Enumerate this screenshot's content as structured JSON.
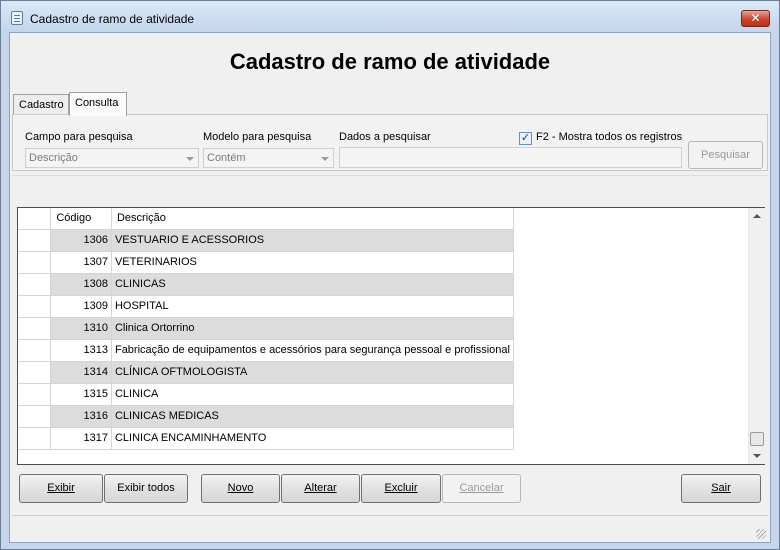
{
  "window": {
    "title": "Cadastro de ramo de atividade",
    "close_glyph": "✕"
  },
  "header": {
    "title": "Cadastro de ramo de atividade"
  },
  "tabs": [
    {
      "label": "Cadastro"
    },
    {
      "label": "Consulta"
    }
  ],
  "search": {
    "campo_label": "Campo para pesquisa",
    "campo_value": "Descrição",
    "modelo_label": "Modelo para pesquisa",
    "modelo_value": "Contém",
    "dados_label": "Dados a pesquisar",
    "dados_value": "",
    "checkbox_label": "F2 - Mostra todos os registros",
    "checkbox_checked": true,
    "pesquisar_label": "Pesquisar"
  },
  "grid": {
    "columns": [
      "Código",
      "Descrição"
    ],
    "rows": [
      {
        "code": "1306",
        "desc": "VESTUARIO E ACESSORIOS"
      },
      {
        "code": "1307",
        "desc": "VETERINARIOS"
      },
      {
        "code": "1308",
        "desc": "CLINICAS"
      },
      {
        "code": "1309",
        "desc": "HOSPITAL"
      },
      {
        "code": "1310",
        "desc": "Clinica Ortorrino"
      },
      {
        "code": "1313",
        "desc": "Fabricação de equipamentos e acessórios para segurança pessoal e profissional"
      },
      {
        "code": "1314",
        "desc": "CLÍNICA OFTMOLOGISTA"
      },
      {
        "code": "1315",
        "desc": "CLINICA"
      },
      {
        "code": "1316",
        "desc": "CLINICAS MEDICAS"
      },
      {
        "code": "1317",
        "desc": "CLINICA ENCAMINHAMENTO"
      }
    ]
  },
  "buttons": {
    "exibir": "Exibir",
    "exibir_todos": "Exibir todos",
    "novo": "Novo",
    "alterar": "Alterar",
    "excluir": "Excluir",
    "cancelar": "Cancelar",
    "sair": "Sair"
  },
  "colors": {
    "title_bar": "#c5d6ea",
    "close_button": "#c6462d",
    "row_alt": "#dcdcdc"
  }
}
